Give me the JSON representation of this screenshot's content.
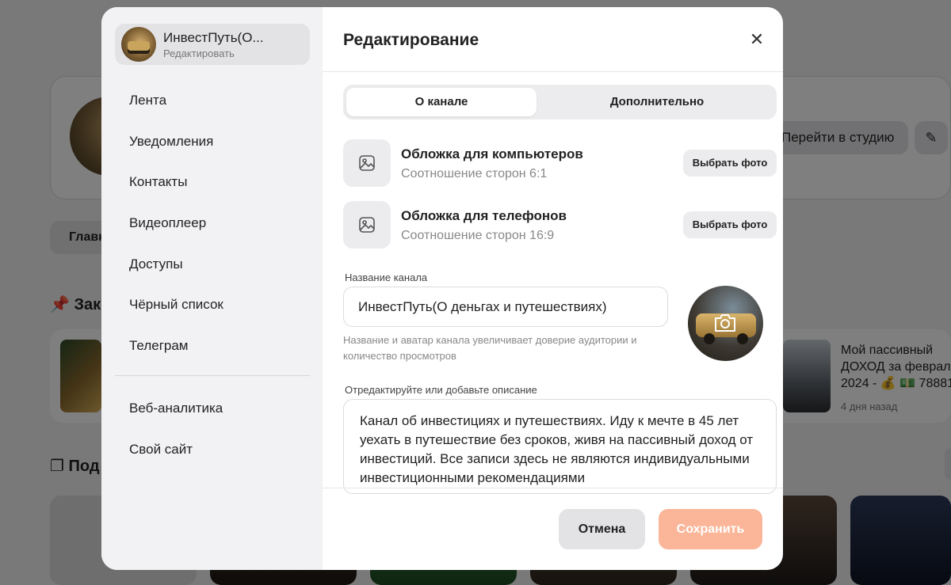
{
  "background": {
    "studio_button": "Перейти в студию",
    "tab_main": "Главн",
    "section1": "Зак",
    "section2": "Под",
    "video_title": "Мой пассивный ДОХОД за феврал 2024 - 💰 💵 78881",
    "video_age": "4 дня назад"
  },
  "sidebar": {
    "channel_name": "ИнвестПуть(О...",
    "channel_sub": "Редактировать",
    "items": [
      "Лента",
      "Уведомления",
      "Контакты",
      "Видеоплеер",
      "Доступы",
      "Чёрный список",
      "Телеграм"
    ],
    "items2": [
      "Веб-аналитика",
      "Свой сайт"
    ]
  },
  "modal": {
    "title": "Редактирование",
    "close": "✕",
    "tabs": [
      {
        "label": "О канале",
        "active": true
      },
      {
        "label": "Дополнительно",
        "active": false
      }
    ],
    "covers": [
      {
        "title": "Обложка для компьютеров",
        "subtitle": "Соотношение сторон 6:1",
        "button": "Выбрать фото"
      },
      {
        "title": "Обложка для телефонов",
        "subtitle": "Соотношение сторон 16:9",
        "button": "Выбрать фото"
      }
    ],
    "name_label": "Название канала",
    "name_value": "ИнвестПуть(О деньгах и путешествиях)",
    "name_hint": "Название и аватар канала увеличивает доверие аудитории и количество просмотров",
    "desc_label": "Отредактируйте или добавьте описание",
    "desc_value": "Канал об инвестициях и путешествиях. Иду к мечте в 45 лет уехать в путешествие без сроков, живя на пассивный доход от инвестиций. Все записи здесь не являются индивидуальными инвестиционными рекомендациями",
    "cancel": "Отмена",
    "save": "Сохранить"
  },
  "colors": {
    "save_button": "#fbb598",
    "sidebar_bg": "#f2f2f4",
    "overlay": "rgba(0,0,0,0.5)"
  },
  "icons": {
    "cover": "image-icon",
    "avatar": "camera-icon",
    "close": "close-icon",
    "edit": "pencil-icon",
    "pin": "pin-icon"
  }
}
